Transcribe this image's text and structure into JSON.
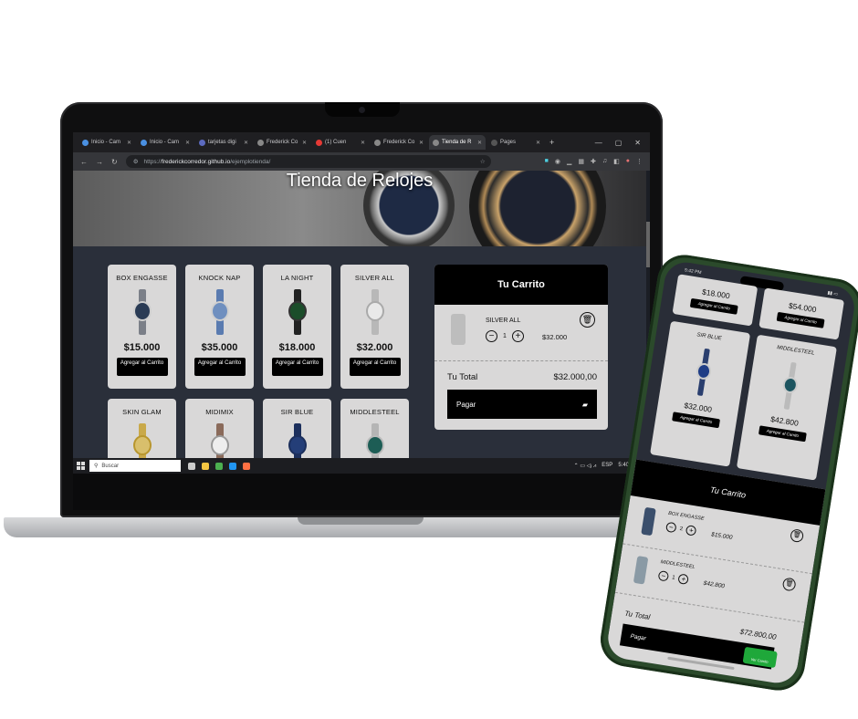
{
  "browser": {
    "tabs": [
      {
        "label": "Inicio - Cam",
        "active": false
      },
      {
        "label": "Inicio - Cam",
        "active": false
      },
      {
        "label": "tarjetas digi",
        "active": false
      },
      {
        "label": "Frederick Co",
        "active": false
      },
      {
        "label": "(1) Cuen",
        "active": false
      },
      {
        "label": "Frederick Co",
        "active": false
      },
      {
        "label": "Tienda de R",
        "active": true
      },
      {
        "label": "Pages",
        "active": false
      }
    ],
    "url_prefix": "https://",
    "url_domain": "frederickcorredor.github.io",
    "url_path": "/ejemplotienda/"
  },
  "store": {
    "title": "Tienda de Relojes",
    "add_label": "Agregar al Carrito",
    "products": [
      {
        "name": "BOX ENGASSE",
        "price": "$15.000"
      },
      {
        "name": "KNOCK NAP",
        "price": "$35.000"
      },
      {
        "name": "LA NIGHT",
        "price": "$18.000"
      },
      {
        "name": "SILVER ALL",
        "price": "$32.000"
      },
      {
        "name": "SKIN GLAM",
        "price": ""
      },
      {
        "name": "MIDIMIX",
        "price": ""
      },
      {
        "name": "SIR BLUE",
        "price": ""
      },
      {
        "name": "MIDDLESTEEL",
        "price": ""
      }
    ],
    "cart": {
      "title": "Tu Carrito",
      "item_name": "SILVER ALL",
      "item_qty": "1",
      "item_price": "$32.000",
      "total_label": "Tu Total",
      "total_value": "$32.000,00",
      "pay_label": "Pagar"
    }
  },
  "taskbar": {
    "search_label": "Buscar",
    "lang": "ESP",
    "time": "5:40 p. m."
  },
  "phone": {
    "time": "5:42 PM",
    "top_prices": [
      "$18.000",
      "$54.000"
    ],
    "add_label": "Agregar al Carrito",
    "products": [
      {
        "name": "SIR BLUE",
        "price": "$32.000"
      },
      {
        "name": "MIDDLESTEEL",
        "price": "$42.800"
      }
    ],
    "cart": {
      "title": "Tu Carrito",
      "items": [
        {
          "name": "BOX ENGASSE",
          "qty": "2",
          "price": "$15.000"
        },
        {
          "name": "MIDDLESTEEL",
          "qty": "1",
          "price": "$42.800"
        }
      ],
      "total_label": "Tu Total",
      "total_value": "$72.800,00",
      "pay_label": "Pagar",
      "ver_label": "Ver Carrito"
    }
  }
}
